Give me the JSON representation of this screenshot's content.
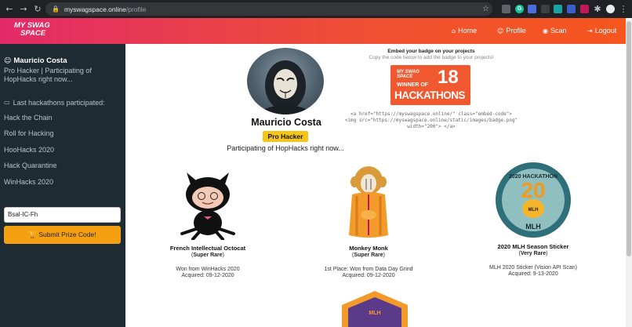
{
  "browser": {
    "url_domain": "myswagspace.online",
    "url_path": "/profile"
  },
  "header": {
    "logo_line1": "MY SWAG",
    "logo_line2": "SPACE",
    "nav": [
      {
        "label": "Home",
        "icon": "home-icon"
      },
      {
        "label": "Profile",
        "icon": "person-icon"
      },
      {
        "label": "Scan",
        "icon": "scan-icon"
      },
      {
        "label": "Logout",
        "icon": "logout-icon"
      }
    ]
  },
  "sidebar": {
    "name": "Mauricio Costa",
    "bio": "Pro Hacker | Participating of HopHacks right now...",
    "hackathons_heading": "Last hackathons participated:",
    "hackathons": [
      "Hack the Chain",
      "Roll for Hacking",
      "HooHacks 2020",
      "Hack Quarantine",
      "WinHacks 2020"
    ],
    "prize_input_value": "Bsal-IC-Fh",
    "submit_label": "Submit Prize Code!"
  },
  "profile": {
    "name": "Mauricio Costa",
    "level": "Pro Hacker",
    "status": "Participating of HopHacks right now..."
  },
  "embed": {
    "title": "Embed your badge on your projects",
    "subtitle": "Copy the code below to add the badge to your projects!",
    "badge_number": "18",
    "badge_winner": "WINNER OF",
    "badge_word": "HACKATHONS",
    "code_line1": "<a href=\"https://myswagspace.online/\" class=\"embed-code\">",
    "code_line2": "<img src=\"https://myswagspace.online/static/images/badge.png\"",
    "code_line3": "width=\"200\"> </a>"
  },
  "stickers": [
    {
      "name": "French Intellectual Octocat",
      "rarity": "Super Rare",
      "from": "Won from WinHacks 2020",
      "acquired": "Acquired: 09-12-2020"
    },
    {
      "name": "Monkey Monk",
      "rarity": "Super Rare",
      "from": "1st Place: Won from Data Day Grind",
      "acquired": "Acquired: 09-12-2020"
    },
    {
      "name": "2020 MLH Season Sticker",
      "rarity": "Very Rare",
      "from": "MLH 2020 Sticker (Vision API Scan)",
      "acquired": "Acquired: 9-13-2020"
    }
  ],
  "colors": {
    "header_start": "#e32a68",
    "header_end": "#f6561e",
    "sidebar_bg": "#1f2b33",
    "submit_btn": "#f5a011",
    "level_badge": "#f5c518"
  }
}
